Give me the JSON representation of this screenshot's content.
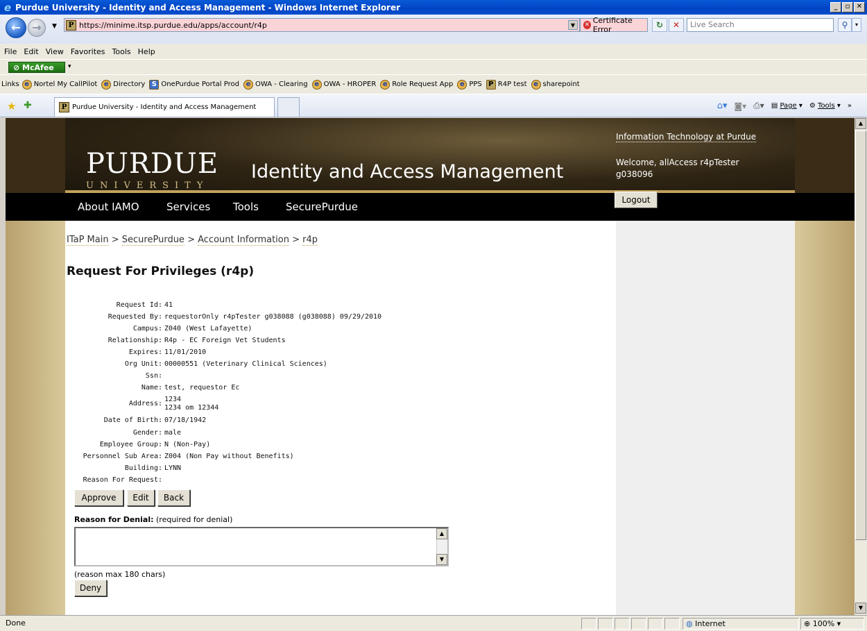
{
  "window": {
    "title": "Purdue University - Identity and Access Management - Windows Internet Explorer"
  },
  "address": {
    "url": "https://minime.itsp.purdue.edu/apps/account/r4p",
    "cert_error": "Certificate Error",
    "search_placeholder": "Live Search"
  },
  "menu": [
    "File",
    "Edit",
    "View",
    "Favorites",
    "Tools",
    "Help"
  ],
  "mcafee": "McAfee",
  "links": {
    "label": "Links",
    "items": [
      "Nortel My CallPilot",
      "Directory",
      "OnePurdue Portal Prod",
      "OWA - Clearing",
      "OWA - HROPER",
      "Role Request App",
      "PPS",
      "R4P test",
      "sharepoint"
    ]
  },
  "tab": {
    "title": "Purdue University - Identity and Access Management"
  },
  "cmdbar": {
    "page": "Page",
    "tools": "Tools"
  },
  "header": {
    "purdue": "PURDUE",
    "university": "UNIVERSITY",
    "site_title": "Identity and Access Management",
    "itap_link": "Information Technology at Purdue",
    "welcome_line1": "Welcome, allAccess r4pTester",
    "welcome_line2": "g038096",
    "logout": "Logout"
  },
  "nav": [
    "About IAMO",
    "Services",
    "Tools",
    "SecurePurdue"
  ],
  "breadcrumb": [
    "ITaP Main",
    "SecurePurdue",
    "Account Information",
    "r4p"
  ],
  "page_title": "Request For Privileges (r4p)",
  "fields": [
    {
      "label": "Request Id:",
      "value": "41"
    },
    {
      "label": "Requested By:",
      "value": "requestorOnly r4pTester g038088 (g038088) 09/29/2010"
    },
    {
      "label": "Campus:",
      "value": "Z040 (West Lafayette)"
    },
    {
      "label": "Relationship:",
      "value": "R4p - EC Foreign Vet Students"
    },
    {
      "label": "Expires:",
      "value": "11/01/2010"
    },
    {
      "label": "Org Unit:",
      "value": "00000551 (Veterinary Clinical Sciences)"
    },
    {
      "label": "Ssn:",
      "value": ""
    },
    {
      "label": "Name:",
      "value": "test, requestor Ec"
    },
    {
      "label": "Address:",
      "value": "1234",
      "value2": "1234 om 12344"
    },
    {
      "label": "Date of Birth:",
      "value": "07/18/1942"
    },
    {
      "label": "Gender:",
      "value": "male"
    },
    {
      "label": "Employee Group:",
      "value": "N (Non-Pay)"
    },
    {
      "label": "Personnel Sub Area:",
      "value": "Z004 (Non Pay without Benefits)"
    },
    {
      "label": "Building:",
      "value": "LYNN"
    },
    {
      "label": "Reason For Request:",
      "value": ""
    }
  ],
  "buttons": {
    "approve": "Approve",
    "edit": "Edit",
    "back": "Back",
    "deny": "Deny"
  },
  "denial": {
    "label": "Reason for Denial:",
    "hint": "(required for denial)",
    "max_note": "(reason max 180 chars)"
  },
  "status": {
    "text": "Done",
    "zone": "Internet",
    "zoom": "100%"
  }
}
